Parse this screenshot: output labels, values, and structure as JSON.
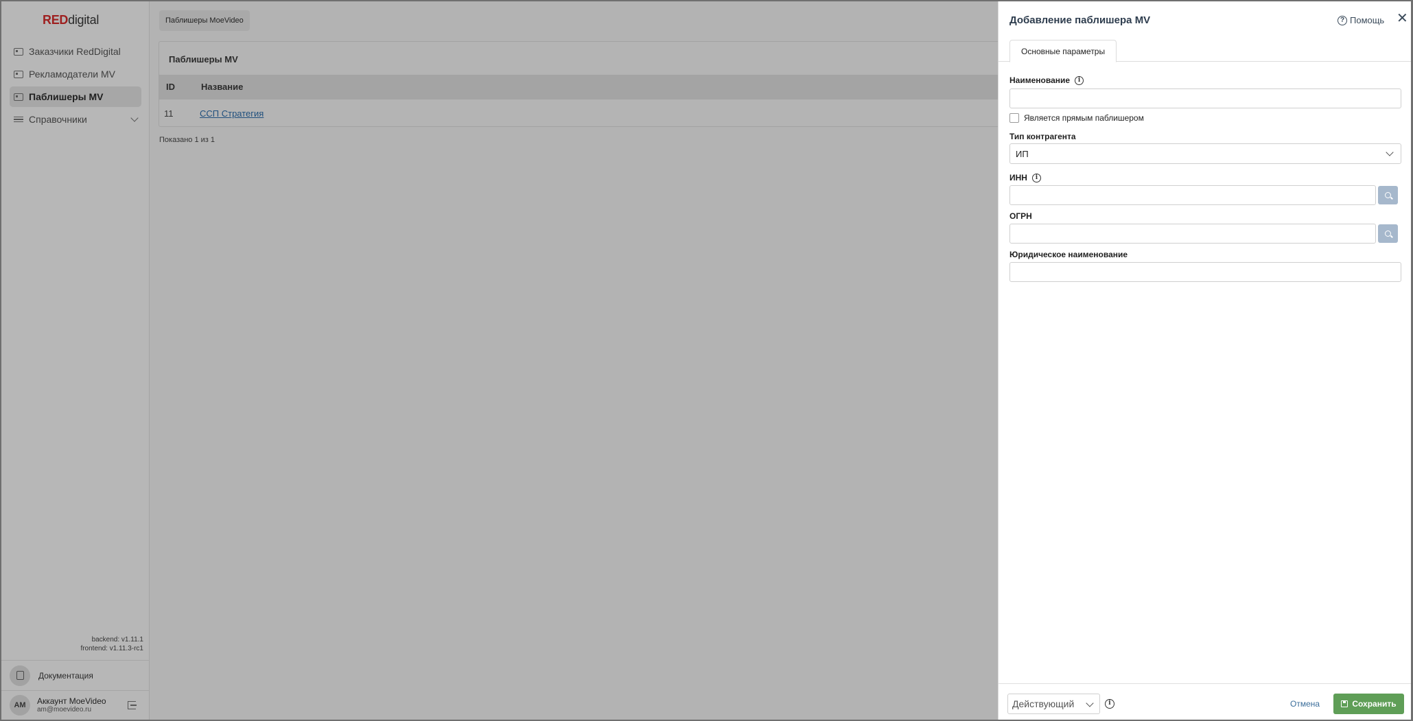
{
  "sidebar": {
    "logo_red": "RED",
    "logo_rest": "digital",
    "items": [
      {
        "label": "Заказчики RedDigital"
      },
      {
        "label": "Рекламодатели MV"
      },
      {
        "label": "Паблишеры MV"
      },
      {
        "label": "Справочники"
      }
    ],
    "backend_version": "backend: v1.11.1",
    "frontend_version": "frontend: v1.11.3-rc1",
    "docs_label": "Документация",
    "account": {
      "initials": "AM",
      "name": "Аккаунт MoeVideo",
      "email": "am@moevideo.ru"
    }
  },
  "main": {
    "breadcrumb": "Паблишеры MoeVideo",
    "panel_title": "Паблишеры MV",
    "columns": [
      "ID",
      "Название"
    ],
    "rows": [
      {
        "id": "11",
        "name": "ССП Стратегия"
      }
    ],
    "shown_text": "Показано 1 из 1"
  },
  "drawer": {
    "title": "Добавление паблишера MV",
    "help_label": "Помощь",
    "close": "✕",
    "tab": "Основные параметры",
    "fields": {
      "name_label": "Наименование",
      "name_value": "",
      "direct_publisher_label": "Является прямым паблишером",
      "contractor_type_label": "Тип контрагента",
      "contractor_type_value": "ИП",
      "inn_label": "ИНН",
      "inn_value": "",
      "ogrn_label": "ОГРН",
      "ogrn_value": "",
      "legal_name_label": "Юридическое наименование",
      "legal_name_value": ""
    },
    "footer": {
      "status_value": "Действующий",
      "cancel_label": "Отмена",
      "save_label": "Сохранить"
    }
  }
}
